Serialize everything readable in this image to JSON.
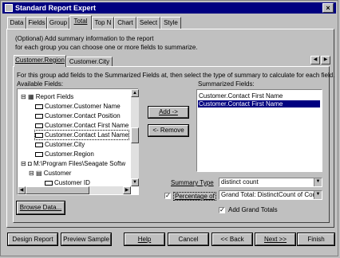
{
  "window": {
    "title": "Standard Report Expert"
  },
  "tabs": [
    "Data",
    "Fields",
    "Group",
    "Total",
    "Top N",
    "Chart",
    "Select",
    "Style"
  ],
  "intro": {
    "line1": "(Optional) Add summary information to the report",
    "line2": "for each group you can choose one or more fields to summarize."
  },
  "subtabs": [
    "Customer.Region",
    "Customer.City"
  ],
  "instruction": "For this group add fields to the Summarized Fields at, then select the type of summary to calculate for each field.",
  "available": {
    "label": "Available Fields:",
    "items": [
      "Report Fields",
      "Customer.Customer Name",
      "Customer.Contact Position",
      "Customer.Contact First Name",
      "Customer.Contact Last Name",
      "Customer.City",
      "Customer.Region",
      "M:\\Program Files\\Seagate Softw",
      "Customer",
      "Customer ID"
    ]
  },
  "summarized": {
    "label": "Summarized Fields:",
    "items": [
      "Customer.Contact First Name",
      "Customer.Contact First Name"
    ]
  },
  "buttons": {
    "add": "Add ->",
    "remove": "<- Remove",
    "browse": "Browse Data..."
  },
  "summary": {
    "type_label": "Summary Type",
    "type_value": "distinct count",
    "percentage_label": "Percentage of",
    "percentage_value": "Grand Total: DistinctCount of Cor",
    "grand_totals_label": "Add Grand Totals"
  },
  "footer": {
    "design": "Design Report",
    "preview": "Preview Sample",
    "help": "Help",
    "cancel": "Cancel",
    "back": "<< Back",
    "next": "Next >>",
    "finish": "Finish"
  }
}
